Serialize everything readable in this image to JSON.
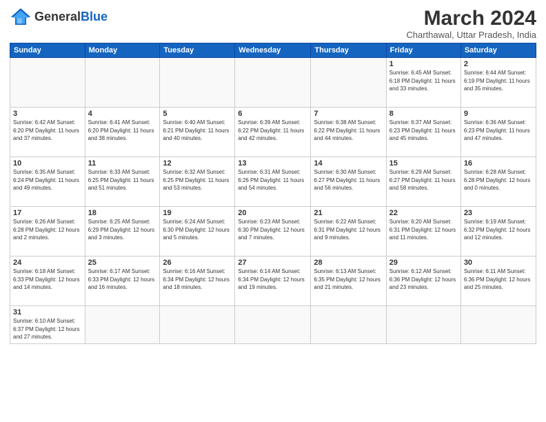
{
  "logo": {
    "text_general": "General",
    "text_blue": "Blue"
  },
  "header": {
    "month_year": "March 2024",
    "location": "Charthawal, Uttar Pradesh, India"
  },
  "weekdays": [
    "Sunday",
    "Monday",
    "Tuesday",
    "Wednesday",
    "Thursday",
    "Friday",
    "Saturday"
  ],
  "weeks": [
    [
      {
        "day": "",
        "info": ""
      },
      {
        "day": "",
        "info": ""
      },
      {
        "day": "",
        "info": ""
      },
      {
        "day": "",
        "info": ""
      },
      {
        "day": "",
        "info": ""
      },
      {
        "day": "1",
        "info": "Sunrise: 6:45 AM\nSunset: 6:18 PM\nDaylight: 11 hours\nand 33 minutes."
      },
      {
        "day": "2",
        "info": "Sunrise: 6:44 AM\nSunset: 6:19 PM\nDaylight: 11 hours\nand 35 minutes."
      }
    ],
    [
      {
        "day": "3",
        "info": "Sunrise: 6:42 AM\nSunset: 6:20 PM\nDaylight: 11 hours\nand 37 minutes."
      },
      {
        "day": "4",
        "info": "Sunrise: 6:41 AM\nSunset: 6:20 PM\nDaylight: 11 hours\nand 38 minutes."
      },
      {
        "day": "5",
        "info": "Sunrise: 6:40 AM\nSunset: 6:21 PM\nDaylight: 11 hours\nand 40 minutes."
      },
      {
        "day": "6",
        "info": "Sunrise: 6:39 AM\nSunset: 6:22 PM\nDaylight: 11 hours\nand 42 minutes."
      },
      {
        "day": "7",
        "info": "Sunrise: 6:38 AM\nSunset: 6:22 PM\nDaylight: 11 hours\nand 44 minutes."
      },
      {
        "day": "8",
        "info": "Sunrise: 6:37 AM\nSunset: 6:23 PM\nDaylight: 11 hours\nand 45 minutes."
      },
      {
        "day": "9",
        "info": "Sunrise: 6:36 AM\nSunset: 6:23 PM\nDaylight: 11 hours\nand 47 minutes."
      }
    ],
    [
      {
        "day": "10",
        "info": "Sunrise: 6:35 AM\nSunset: 6:24 PM\nDaylight: 11 hours\nand 49 minutes."
      },
      {
        "day": "11",
        "info": "Sunrise: 6:33 AM\nSunset: 6:25 PM\nDaylight: 11 hours\nand 51 minutes."
      },
      {
        "day": "12",
        "info": "Sunrise: 6:32 AM\nSunset: 6:25 PM\nDaylight: 11 hours\nand 53 minutes."
      },
      {
        "day": "13",
        "info": "Sunrise: 6:31 AM\nSunset: 6:26 PM\nDaylight: 11 hours\nand 54 minutes."
      },
      {
        "day": "14",
        "info": "Sunrise: 6:30 AM\nSunset: 6:27 PM\nDaylight: 11 hours\nand 56 minutes."
      },
      {
        "day": "15",
        "info": "Sunrise: 6:29 AM\nSunset: 6:27 PM\nDaylight: 11 hours\nand 58 minutes."
      },
      {
        "day": "16",
        "info": "Sunrise: 6:28 AM\nSunset: 6:28 PM\nDaylight: 12 hours\nand 0 minutes."
      }
    ],
    [
      {
        "day": "17",
        "info": "Sunrise: 6:26 AM\nSunset: 6:28 PM\nDaylight: 12 hours\nand 2 minutes."
      },
      {
        "day": "18",
        "info": "Sunrise: 6:25 AM\nSunset: 6:29 PM\nDaylight: 12 hours\nand 3 minutes."
      },
      {
        "day": "19",
        "info": "Sunrise: 6:24 AM\nSunset: 6:30 PM\nDaylight: 12 hours\nand 5 minutes."
      },
      {
        "day": "20",
        "info": "Sunrise: 6:23 AM\nSunset: 6:30 PM\nDaylight: 12 hours\nand 7 minutes."
      },
      {
        "day": "21",
        "info": "Sunrise: 6:22 AM\nSunset: 6:31 PM\nDaylight: 12 hours\nand 9 minutes."
      },
      {
        "day": "22",
        "info": "Sunrise: 6:20 AM\nSunset: 6:31 PM\nDaylight: 12 hours\nand 11 minutes."
      },
      {
        "day": "23",
        "info": "Sunrise: 6:19 AM\nSunset: 6:32 PM\nDaylight: 12 hours\nand 12 minutes."
      }
    ],
    [
      {
        "day": "24",
        "info": "Sunrise: 6:18 AM\nSunset: 6:33 PM\nDaylight: 12 hours\nand 14 minutes."
      },
      {
        "day": "25",
        "info": "Sunrise: 6:17 AM\nSunset: 6:33 PM\nDaylight: 12 hours\nand 16 minutes."
      },
      {
        "day": "26",
        "info": "Sunrise: 6:16 AM\nSunset: 6:34 PM\nDaylight: 12 hours\nand 18 minutes."
      },
      {
        "day": "27",
        "info": "Sunrise: 6:14 AM\nSunset: 6:34 PM\nDaylight: 12 hours\nand 19 minutes."
      },
      {
        "day": "28",
        "info": "Sunrise: 6:13 AM\nSunset: 6:35 PM\nDaylight: 12 hours\nand 21 minutes."
      },
      {
        "day": "29",
        "info": "Sunrise: 6:12 AM\nSunset: 6:36 PM\nDaylight: 12 hours\nand 23 minutes."
      },
      {
        "day": "30",
        "info": "Sunrise: 6:11 AM\nSunset: 6:36 PM\nDaylight: 12 hours\nand 25 minutes."
      }
    ],
    [
      {
        "day": "31",
        "info": "Sunrise: 6:10 AM\nSunset: 6:37 PM\nDaylight: 12 hours\nand 27 minutes."
      },
      {
        "day": "",
        "info": ""
      },
      {
        "day": "",
        "info": ""
      },
      {
        "day": "",
        "info": ""
      },
      {
        "day": "",
        "info": ""
      },
      {
        "day": "",
        "info": ""
      },
      {
        "day": "",
        "info": ""
      }
    ]
  ]
}
